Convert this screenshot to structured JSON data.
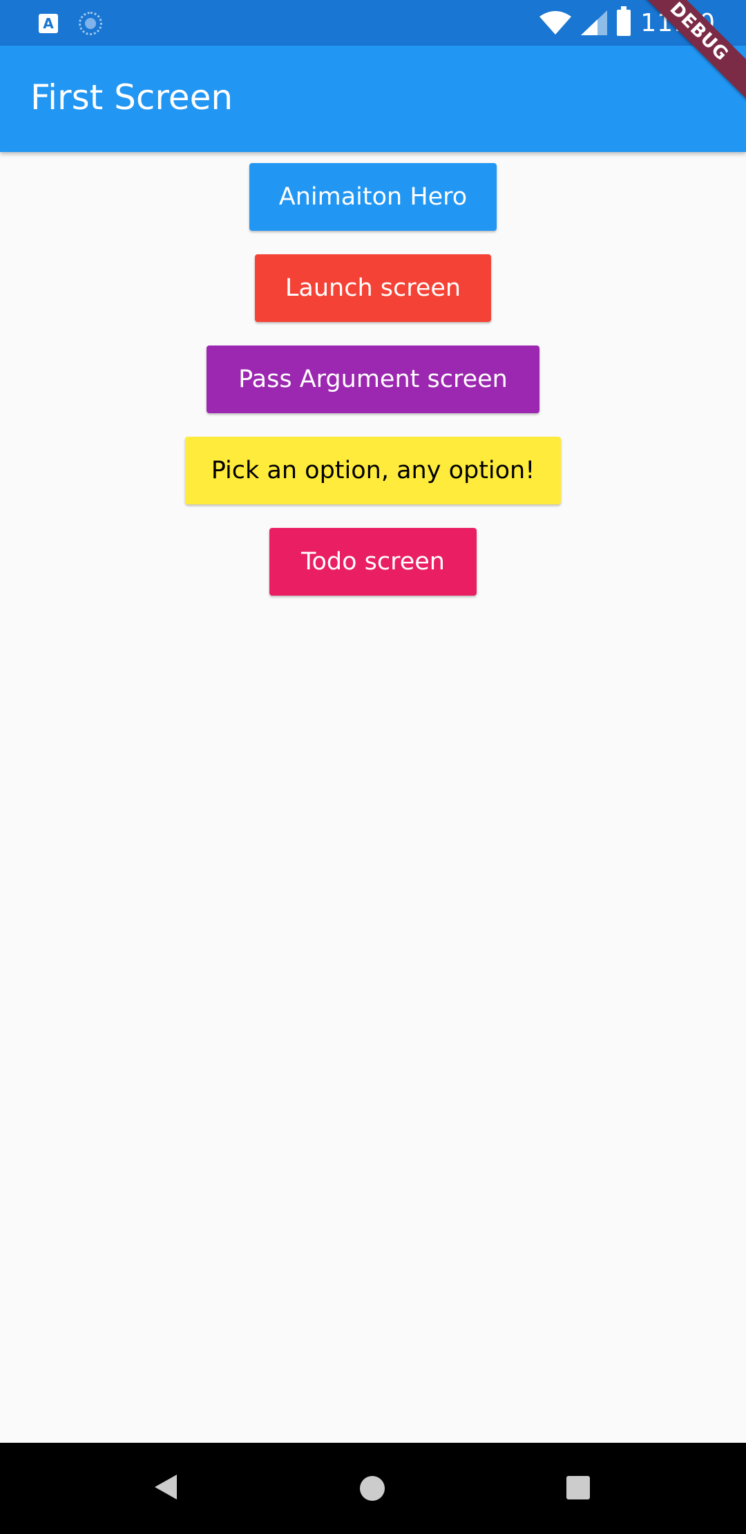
{
  "status_bar": {
    "time": "11:10",
    "icons": [
      "app-a-icon",
      "sync-icon",
      "wifi-icon",
      "cellular-signal-icon",
      "battery-icon"
    ]
  },
  "app_bar": {
    "title": "First Screen"
  },
  "debug_banner": {
    "label": "DEBUG"
  },
  "buttons": [
    {
      "label": "Animaiton Hero",
      "color": "#2196f3",
      "text_color": "#ffffff"
    },
    {
      "label": "Launch screen",
      "color": "#f44336",
      "text_color": "#ffffff"
    },
    {
      "label": "Pass Argument screen",
      "color": "#9c27b0",
      "text_color": "#ffffff"
    },
    {
      "label": "Pick an option, any option!",
      "color": "#ffeb3b",
      "text_color": "#000000"
    },
    {
      "label": "Todo screen",
      "color": "#e91e63",
      "text_color": "#ffffff"
    }
  ],
  "nav_bar": {
    "icons": [
      "back-icon",
      "home-icon",
      "recents-icon"
    ]
  }
}
